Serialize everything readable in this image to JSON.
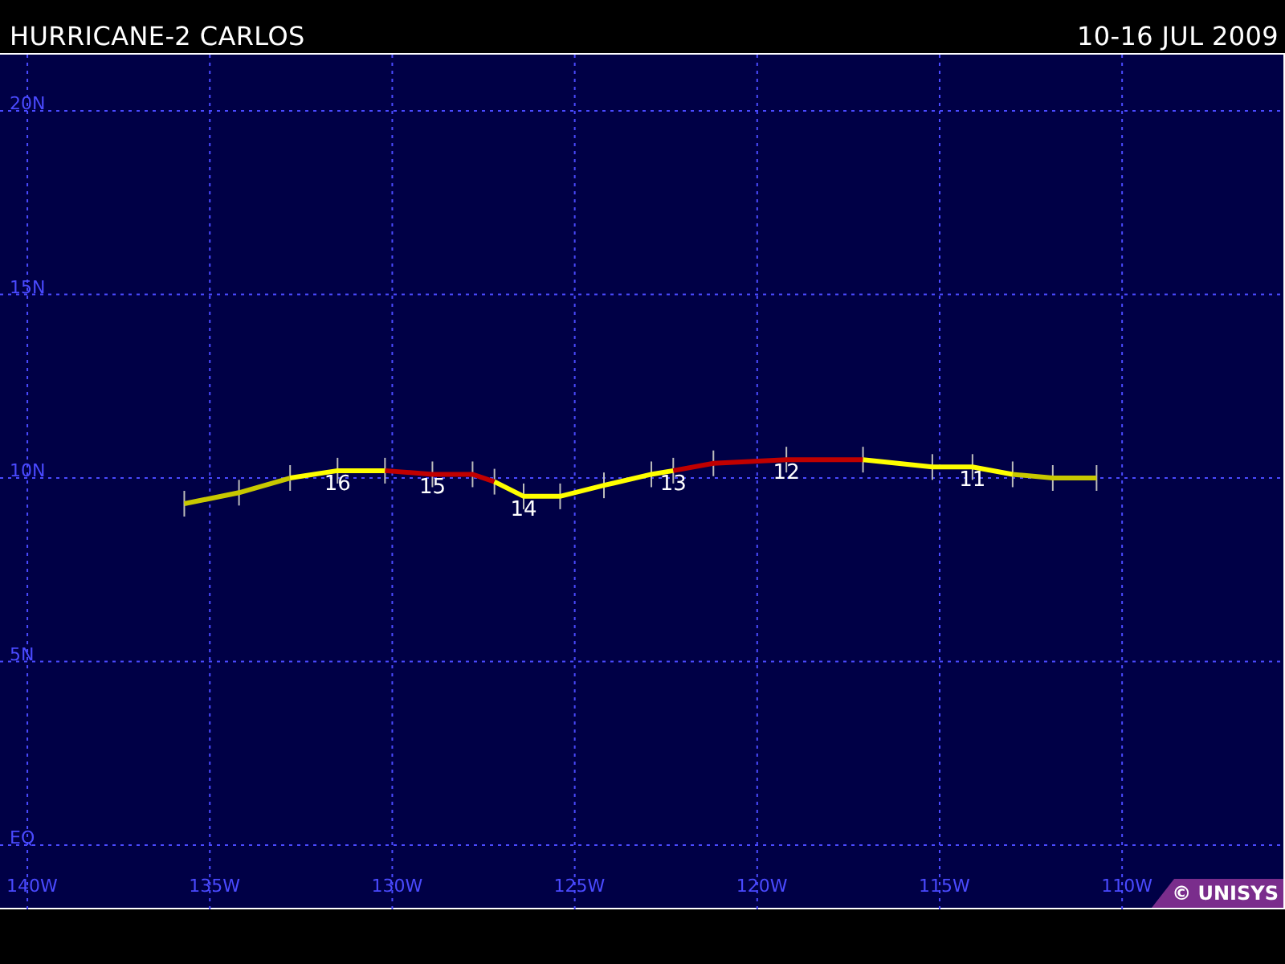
{
  "header": {
    "title": "HURRICANE-2 CARLOS",
    "dates": "10-16 JUL 2009"
  },
  "map": {
    "chart_data": {
      "type": "line",
      "x": [
        -135.7,
        -134.2,
        -132.8,
        -131.5,
        -130.2,
        -128.9,
        -127.8,
        -127.2,
        -126.4,
        -125.4,
        -124.2,
        -122.9,
        -122.3,
        -121.2,
        -119.2,
        -117.1,
        -115.2,
        -114.1,
        -113.0,
        -111.9,
        -110.7
      ],
      "series": [
        {
          "color": "#c8c800",
          "values": [
            9.3,
            9.6,
            10.0,
            null,
            null,
            null,
            null,
            null,
            null,
            null,
            null,
            null,
            null,
            null,
            null,
            null,
            null,
            null,
            null,
            null,
            null
          ]
        },
        {
          "color": "#ffff00",
          "values": [
            null,
            null,
            10.0,
            10.2,
            10.2,
            null,
            null,
            null,
            null,
            null,
            null,
            null,
            null,
            null,
            null,
            null,
            null,
            null,
            null,
            null,
            null
          ]
        },
        {
          "color": "#c00000",
          "values": [
            null,
            null,
            null,
            null,
            10.2,
            10.1,
            10.1,
            9.9,
            null,
            null,
            null,
            null,
            null,
            null,
            null,
            null,
            null,
            null,
            null,
            null,
            null
          ]
        },
        {
          "color": "#ffff00",
          "values": [
            null,
            null,
            null,
            null,
            null,
            null,
            null,
            9.9,
            9.5,
            9.5,
            9.8,
            10.1,
            10.2,
            null,
            null,
            null,
            null,
            null,
            null,
            null,
            null
          ]
        },
        {
          "color": "#c00000",
          "values": [
            null,
            null,
            null,
            null,
            null,
            null,
            null,
            null,
            null,
            null,
            null,
            null,
            10.2,
            10.4,
            10.5,
            10.5,
            null,
            null,
            null,
            null,
            null
          ]
        },
        {
          "color": "#ffff00",
          "values": [
            null,
            null,
            null,
            null,
            null,
            null,
            null,
            null,
            null,
            null,
            null,
            null,
            null,
            null,
            null,
            10.5,
            10.3,
            10.3,
            10.1,
            null,
            null
          ]
        },
        {
          "color": "#c8c800",
          "values": [
            null,
            null,
            null,
            null,
            null,
            null,
            null,
            null,
            null,
            null,
            null,
            null,
            null,
            null,
            null,
            null,
            null,
            null,
            10.1,
            10.0,
            10.0
          ]
        }
      ],
      "xlim": [
        -140.75,
        -105.58
      ],
      "ylim": [
        -3.238,
        23.02
      ],
      "grid": true,
      "xticks": [
        {
          "value": -140,
          "label": "140W"
        },
        {
          "value": -135,
          "label": "135W"
        },
        {
          "value": -130,
          "label": "130W"
        },
        {
          "value": -125,
          "label": "125W"
        },
        {
          "value": -120,
          "label": "120W"
        },
        {
          "value": -115,
          "label": "115W"
        },
        {
          "value": -110,
          "label": "110W"
        }
      ],
      "yticks": [
        {
          "value": 0,
          "label": "EQ"
        },
        {
          "value": 5,
          "label": "5N"
        },
        {
          "value": 10,
          "label": "10N"
        },
        {
          "value": 15,
          "label": "15N"
        },
        {
          "value": 20,
          "label": "20N"
        }
      ],
      "annotations": [
        {
          "text": "16",
          "x": -131.5,
          "y": 10.2
        },
        {
          "text": "15",
          "x": -128.9,
          "y": 10.1
        },
        {
          "text": "14",
          "x": -126.4,
          "y": 9.5
        },
        {
          "text": "13",
          "x": -122.3,
          "y": 10.2
        },
        {
          "text": "12",
          "x": -119.2,
          "y": 10.5
        },
        {
          "text": "11",
          "x": -114.1,
          "y": 10.3
        }
      ]
    }
  },
  "credit": "© UNISYS"
}
